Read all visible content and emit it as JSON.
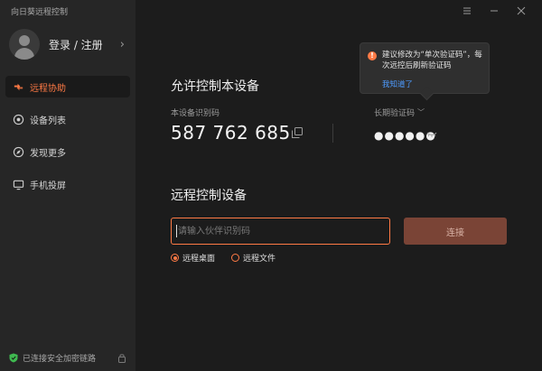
{
  "app": {
    "title": "向日葵远程控制"
  },
  "sidebar": {
    "login_label": "登录 / 注册",
    "items": [
      {
        "label": "远程协助",
        "icon": "remote-assist-icon",
        "active": true
      },
      {
        "label": "设备列表",
        "icon": "device-list-icon",
        "active": false
      },
      {
        "label": "发现更多",
        "icon": "discover-icon",
        "active": false
      },
      {
        "label": "手机投屏",
        "icon": "screen-cast-icon",
        "active": false
      }
    ],
    "footer_status": "已连接安全加密链路"
  },
  "allow": {
    "title": "允许控制本设备",
    "id_label": "本设备识别码",
    "device_id": "587 762 685",
    "password_label": "长期验证码",
    "password_masked": "●●●●●●"
  },
  "tooltip": {
    "text": "建议修改为“单次验证码”，每次远控后刷新验证码",
    "link": "我知道了"
  },
  "remote": {
    "title": "远程控制设备",
    "input_placeholder": "请输入伙伴识别码",
    "connect_label": "连接",
    "options": [
      {
        "label": "远程桌面",
        "selected": true
      },
      {
        "label": "远程文件",
        "selected": false
      }
    ]
  },
  "colors": {
    "accent": "#ff7a45",
    "connect_button": "#7a4436",
    "link": "#4d9bff",
    "sidebar_bg": "#262626",
    "main_bg": "#1c1c1c"
  }
}
